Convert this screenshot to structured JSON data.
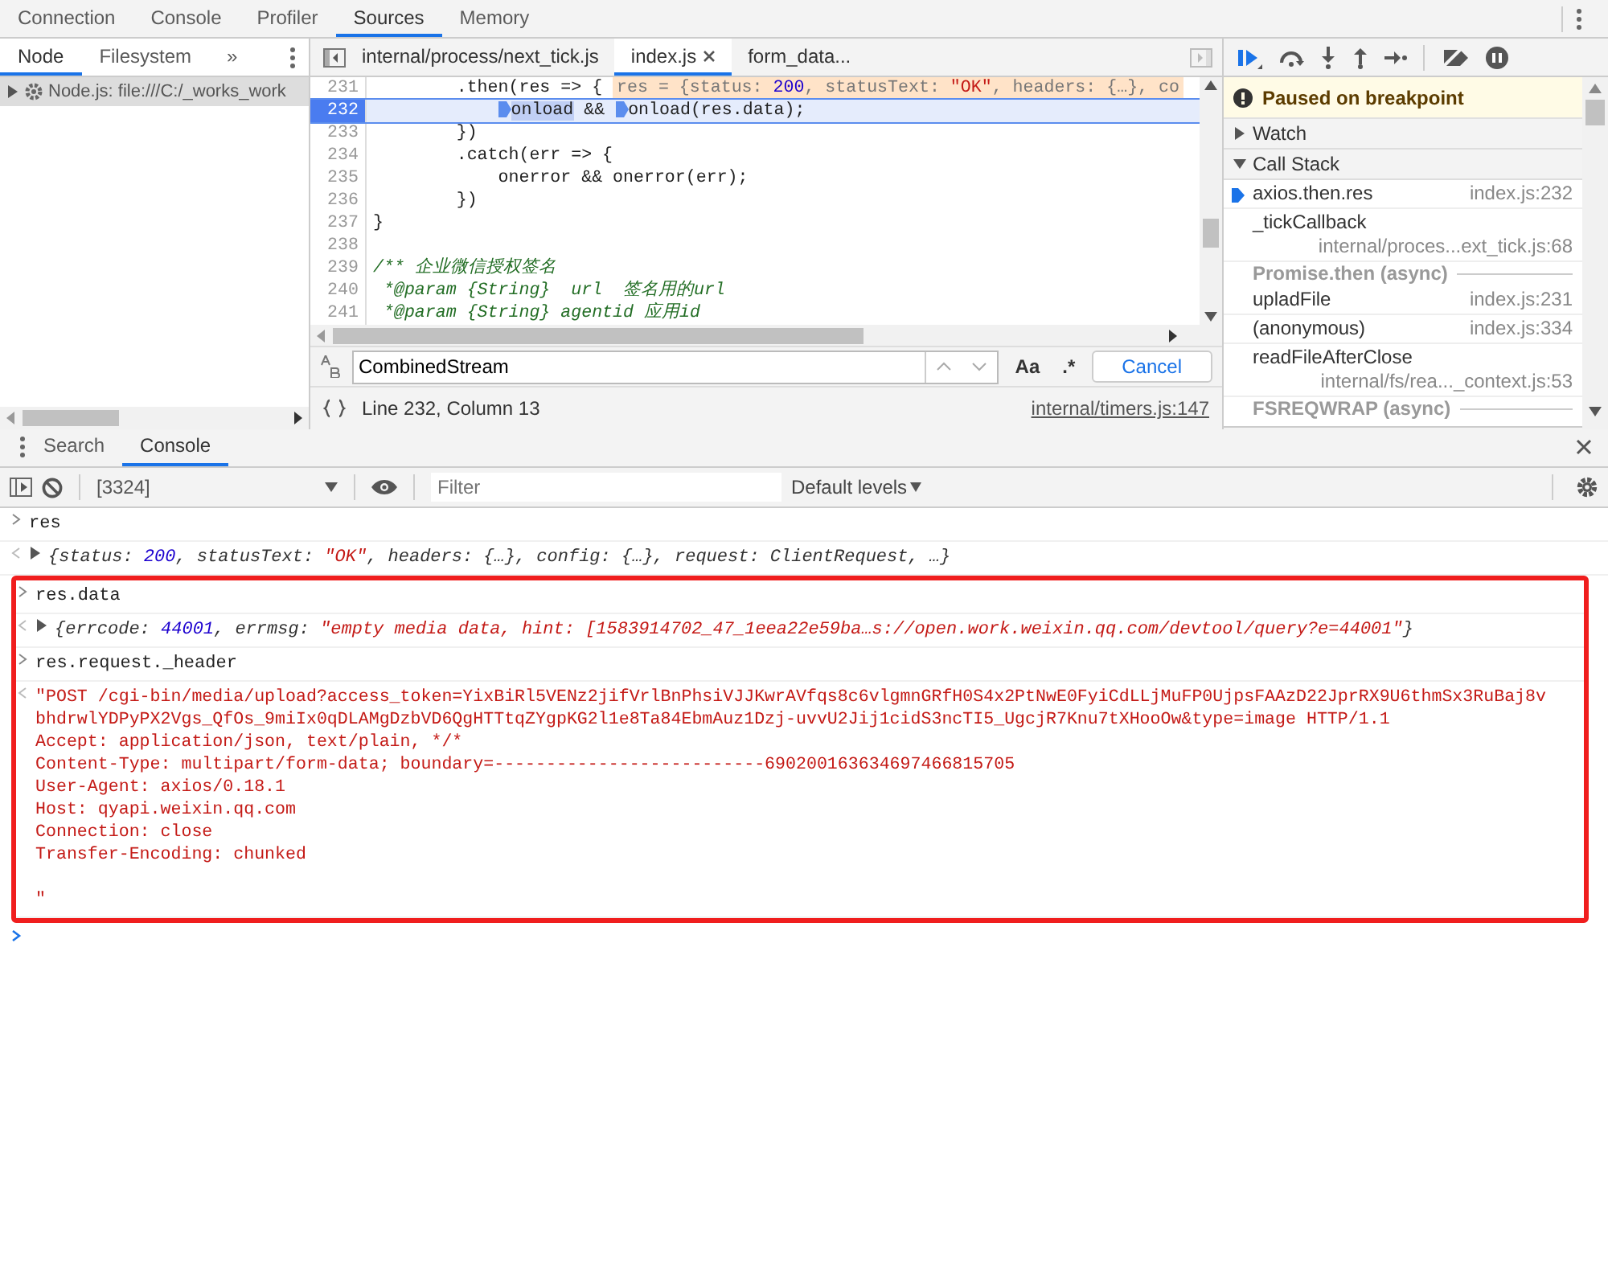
{
  "top_tabs": [
    {
      "label": "Connection",
      "selected": false
    },
    {
      "label": "Console",
      "selected": false
    },
    {
      "label": "Profiler",
      "selected": false
    },
    {
      "label": "Sources",
      "selected": true
    },
    {
      "label": "Memory",
      "selected": false
    }
  ],
  "navigator": {
    "tabs": [
      {
        "label": "Node",
        "selected": true
      },
      {
        "label": "Filesystem",
        "selected": false
      }
    ],
    "more": "»",
    "tree": [
      {
        "label": "Node.js: file:///C:/_works_work",
        "selected": true,
        "expanded": false
      }
    ]
  },
  "editor": {
    "tabs": [
      {
        "label": "internal/process/next_tick.js",
        "selected": false,
        "closable": false
      },
      {
        "label": "index.js",
        "selected": true,
        "closable": true
      },
      {
        "label": "form_data...",
        "selected": false,
        "closable": false
      }
    ],
    "lines": [
      {
        "number": "231",
        "current": false,
        "parts": [
          {
            "kind": "plain",
            "t": "        .then(res => {"
          }
        ],
        "inline": [
          {
            "kind": "plain",
            "t": "res = {status: "
          },
          {
            "kind": "number",
            "t": "200"
          },
          {
            "kind": "plain",
            "t": ", statusText: "
          },
          {
            "kind": "string",
            "t": "\"OK\""
          },
          {
            "kind": "plain",
            "t": ", headers: {…}, co"
          }
        ]
      },
      {
        "number": "232",
        "current": true,
        "parts": [
          {
            "kind": "marker"
          },
          {
            "kind": "focus",
            "t": "onload"
          },
          {
            "kind": "plain",
            "t": " && "
          },
          {
            "kind": "marker"
          },
          {
            "kind": "plain",
            "t": "onload(res.data);"
          }
        ]
      },
      {
        "number": "233",
        "current": false,
        "parts": [
          {
            "kind": "plain",
            "t": "        })"
          }
        ]
      },
      {
        "number": "234",
        "current": false,
        "parts": [
          {
            "kind": "plain",
            "t": "        .catch(err => {"
          }
        ]
      },
      {
        "number": "235",
        "current": false,
        "parts": [
          {
            "kind": "plain",
            "t": "            onerror && onerror(err);"
          }
        ]
      },
      {
        "number": "236",
        "current": false,
        "parts": [
          {
            "kind": "plain",
            "t": "        })"
          }
        ]
      },
      {
        "number": "237",
        "current": false,
        "parts": [
          {
            "kind": "plain",
            "t": "}"
          }
        ]
      },
      {
        "number": "238",
        "current": false
      },
      {
        "number": "239",
        "current": false,
        "parts": [
          {
            "kind": "comment",
            "t": "/** 企业微信授权签名"
          }
        ]
      },
      {
        "number": "240",
        "current": false,
        "parts": [
          {
            "kind": "comment",
            "t": " *@param {String}  url  签名用的url"
          }
        ]
      },
      {
        "number": "241",
        "current": false,
        "parts": [
          {
            "kind": "comment",
            "t": " *@param {String} agentid 应用id"
          }
        ]
      }
    ],
    "search": {
      "value": "CombinedStream",
      "match_case": "Aa",
      "regex": ".*",
      "cancel": "Cancel"
    },
    "status": {
      "position": "Line 232, Column 13",
      "link": "internal/timers.js:147"
    }
  },
  "debugger": {
    "paused": "Paused on breakpoint",
    "sections": [
      {
        "title": "Watch",
        "expanded": false
      },
      {
        "title": "Call Stack",
        "expanded": true
      }
    ],
    "call_stack": [
      {
        "kind": "frame",
        "name": "axios.then.res",
        "location": "index.js:232",
        "current": true
      },
      {
        "kind": "frame_long",
        "name": "_tickCallback",
        "location": "internal/proces...ext_tick.js:68",
        "current": false
      },
      {
        "kind": "async",
        "name": "Promise.then (async)",
        "current": false
      },
      {
        "kind": "frame",
        "name": "upladFile",
        "location": "index.js:231",
        "current": false
      },
      {
        "kind": "frame",
        "name": "(anonymous)",
        "location": "index.js:334",
        "current": false
      },
      {
        "kind": "frame_long",
        "name": "readFileAfterClose",
        "location": "internal/fs/rea..._context.js:53",
        "current": false
      },
      {
        "kind": "async",
        "name": "FSREQWRAP (async)",
        "current": false
      }
    ]
  },
  "drawer": {
    "tabs": [
      {
        "label": "Search",
        "selected": false
      },
      {
        "label": "Console",
        "selected": true
      }
    ]
  },
  "console_toolbar": {
    "context": "[3324]",
    "filter_placeholder": "Filter",
    "levels": "Default levels"
  },
  "console": [
    {
      "kind": "input",
      "highlighted": false,
      "parts": [
        {
          "kind": "plain",
          "t": "res"
        }
      ]
    },
    {
      "kind": "result",
      "highlighted": false,
      "parts": [
        {
          "kind": "key",
          "t": "{status: "
        },
        {
          "kind": "number",
          "t": "200"
        },
        {
          "kind": "key",
          "t": ", statusText: "
        },
        {
          "kind": "string",
          "t": "\"OK\""
        },
        {
          "kind": "key",
          "t": ", headers: {…}, config: {…}, request: ClientRequest, …}"
        }
      ]
    },
    {
      "kind": "input",
      "highlighted": true,
      "parts": [
        {
          "kind": "plain",
          "t": "res.data"
        }
      ]
    },
    {
      "kind": "result",
      "highlighted": true,
      "parts": [
        {
          "kind": "key",
          "t": "{errcode: "
        },
        {
          "kind": "number",
          "t": "44001"
        },
        {
          "kind": "key",
          "t": ", errmsg: "
        },
        {
          "kind": "string",
          "t": "\"empty media data, hint: [1583914702_47_1eea22e59ba…s://open.work.weixin.qq.com/devtool/query?e=44001\""
        },
        {
          "kind": "key",
          "t": "}"
        }
      ]
    },
    {
      "kind": "input",
      "highlighted": true,
      "parts": [
        {
          "kind": "plain",
          "t": "res.request._header"
        }
      ]
    },
    {
      "kind": "text_result",
      "highlighted": true,
      "parts": [
        {
          "kind": "string",
          "t": "\"POST /cgi-bin/media/upload?access_token=YixBiRl5VENz2jifVrlBnPhsiVJJKwrAVfqs8c6vlgmnGRfH0S4x2PtNwE0FyiCdLLjMuFP0UjpsFAAzD22JprRX9U6thmSx3RuBaj8v\nbhdrwlYDPyPX2Vgs_QfOs_9miIx0qDLAMgDzbVD6QgHTTtqZYgpKG2l1e8Ta84EbmAuz1Dzj-uvvU2Jij1cidS3ncTI5_UgcjR7Knu7tXHooOw&type=image HTTP/1.1\nAccept: application/json, text/plain, */*\nContent-Type: multipart/form-data; boundary=--------------------------690200163634697466815705\nUser-Agent: axios/0.18.1\nHost: qyapi.weixin.qq.com\nConnection: close\nTransfer-Encoding: chunked\n\n\""
        }
      ]
    }
  ]
}
